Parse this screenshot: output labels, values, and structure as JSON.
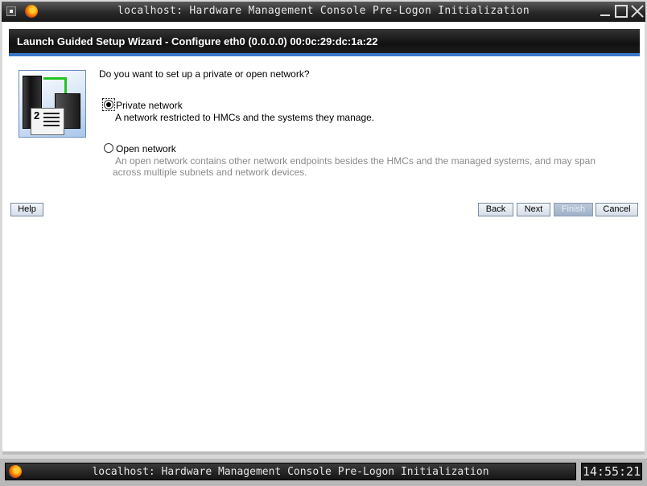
{
  "window": {
    "title": "localhost: Hardware Management Console Pre-Logon Initialization"
  },
  "header": {
    "title": "Launch Guided Setup Wizard - Configure eth0 (0.0.0.0) 00:0c:29:dc:1a:22"
  },
  "wizard": {
    "step_number": "2",
    "question": "Do you want to set up a private or open network?",
    "options": [
      {
        "label": "Private network",
        "description": "A network restricted to HMCs and the systems they manage.",
        "selected": true
      },
      {
        "label": "Open network",
        "description_line1": "An open network contains other network endpoints besides the HMCs and the managed systems, and may span",
        "description_line2": "across multiple subnets and network devices.",
        "selected": false
      }
    ]
  },
  "buttons": {
    "help": "Help",
    "back": "Back",
    "next": "Next",
    "finish": "Finish",
    "cancel": "Cancel"
  },
  "taskbar": {
    "app_title": "localhost: Hardware Management Console Pre-Logon Initialization",
    "clock": "14:55:21"
  },
  "icons": {
    "app": "firefox-icon",
    "window_menu": "window-menu-icon"
  }
}
